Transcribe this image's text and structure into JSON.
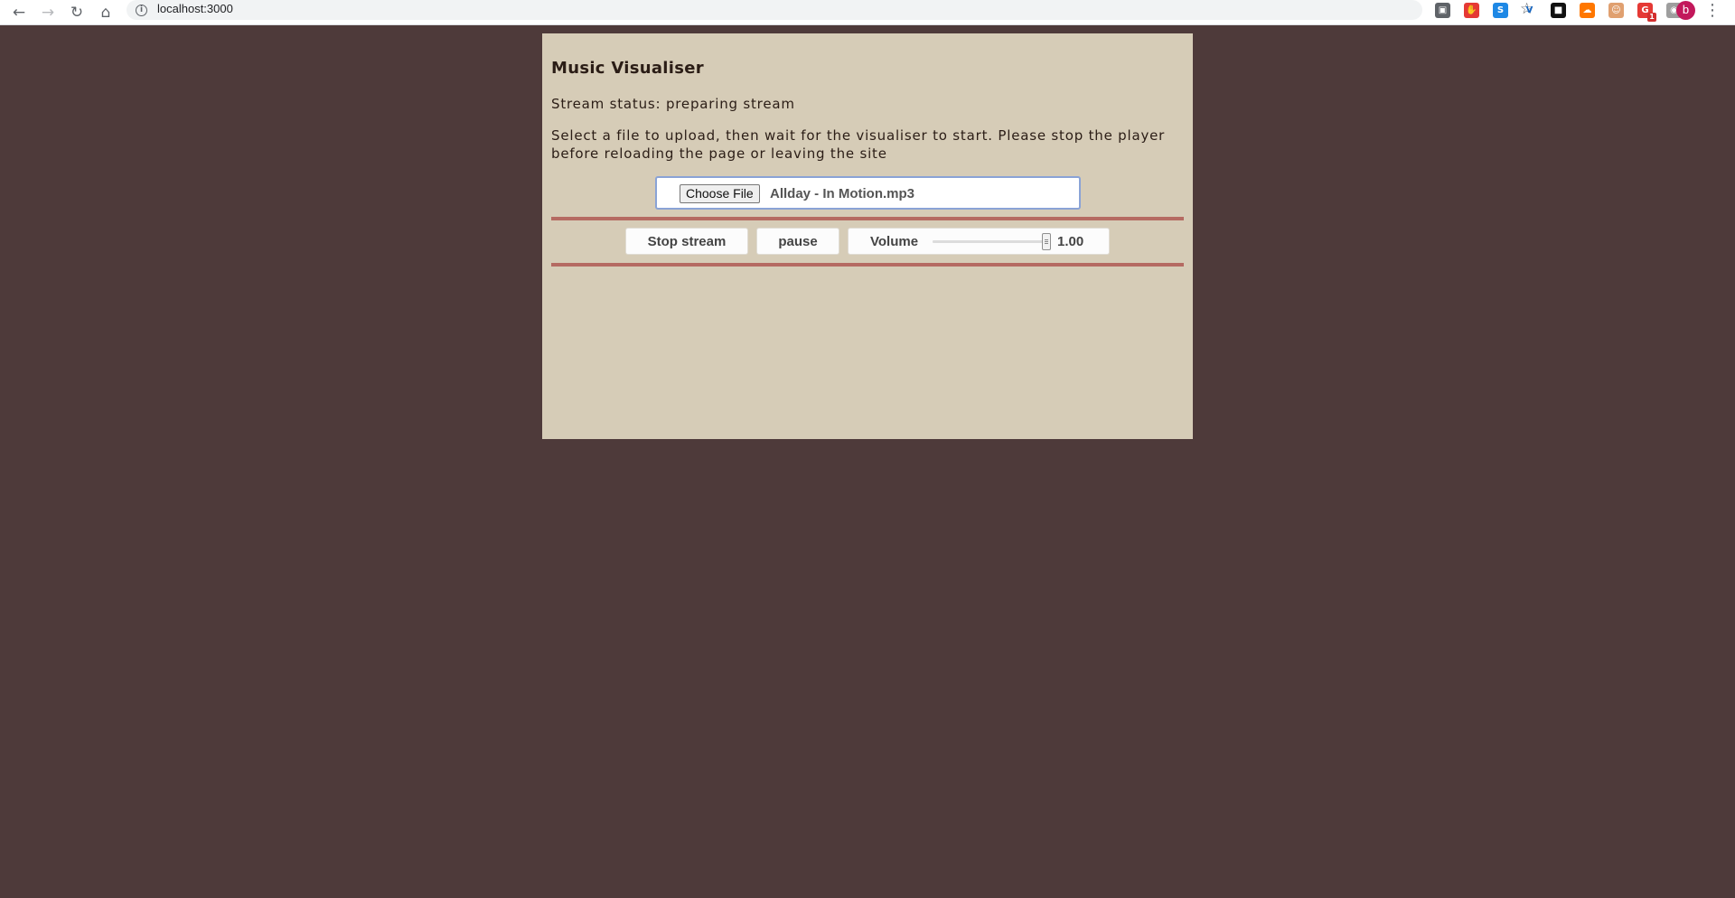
{
  "browser": {
    "url": "localhost:3000",
    "extensions": [
      {
        "name": "notes-extension-icon",
        "color": "#5f6368",
        "glyph": "▣"
      },
      {
        "name": "adblock-extension-icon",
        "color": "#e53935",
        "glyph": "✋"
      },
      {
        "name": "skype-extension-icon",
        "color": "#1e88e5",
        "glyph": "S"
      },
      {
        "name": "vuejs-extension-icon",
        "color": "#ffffff",
        "glyph": "V"
      },
      {
        "name": "dark-extension-icon",
        "color": "#111111",
        "glyph": "■"
      },
      {
        "name": "soundcloud-extension-icon",
        "color": "#ff7700",
        "glyph": "☁"
      },
      {
        "name": "face-extension-icon",
        "color": "#e0a070",
        "glyph": "☺"
      },
      {
        "name": "alert-extension-icon",
        "color": "#e53935",
        "glyph": "G",
        "badge": "1"
      },
      {
        "name": "camera-extension-icon",
        "color": "#9e9e9e",
        "glyph": "◉"
      }
    ],
    "avatar_letter": "b"
  },
  "page": {
    "title": "Music Visualiser",
    "status": "Stream status: preparing stream",
    "instructions": "Select a file to upload, then wait for the visualiser to start. Please stop the player before reloading the page or leaving the site",
    "file_input": {
      "button_label": "Choose File",
      "file_name": "Allday - In Motion.mp3"
    },
    "controls": {
      "stop_label": "Stop stream",
      "pause_label": "pause",
      "volume_label": "Volume",
      "volume_value": "1.00",
      "volume_level": 1.0
    }
  },
  "colors": {
    "background": "#4e3a3a",
    "panel": "#d6ccb7",
    "divider": "#b56a62",
    "text": "#2b1d16"
  }
}
